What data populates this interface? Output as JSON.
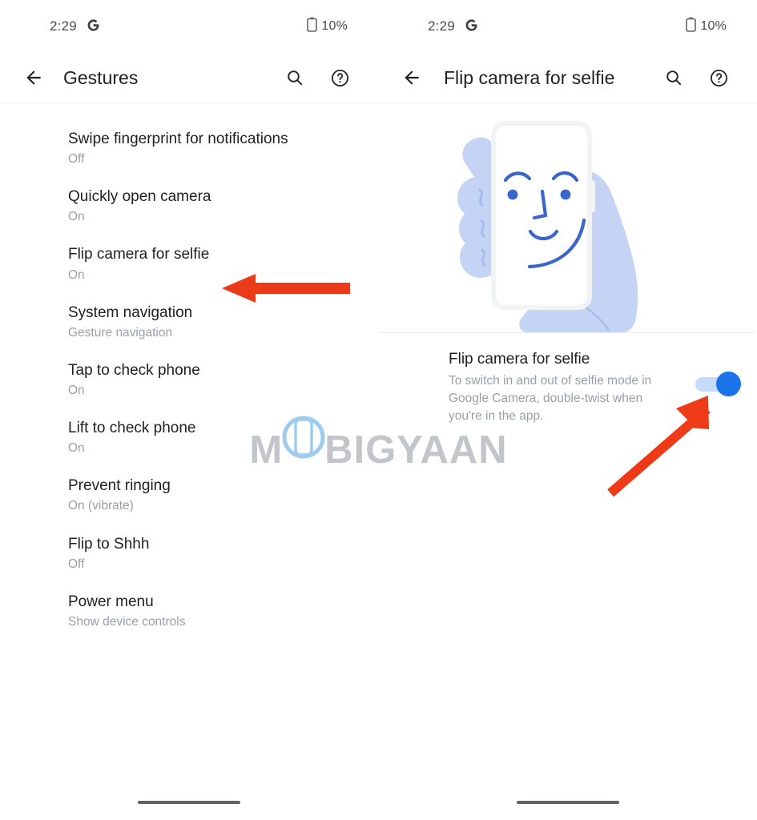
{
  "left_panel": {
    "status_bar": {
      "time": "2:29",
      "app_logo": "google-g-logo",
      "battery_icon": "battery-icon",
      "battery_level": "10%"
    },
    "app_bar": {
      "back_icon": "back-arrow-icon",
      "title": "Gestures",
      "search_icon": "search-icon",
      "help_icon": "help-circle-icon"
    },
    "settings": [
      {
        "title": "Swipe fingerprint for notifications",
        "value": "Off"
      },
      {
        "title": "Quickly open camera",
        "value": "On"
      },
      {
        "title": "Flip camera for selfie",
        "value": "On"
      },
      {
        "title": "System navigation",
        "value": "Gesture navigation"
      },
      {
        "title": "Tap to check phone",
        "value": "On"
      },
      {
        "title": "Lift to check phone",
        "value": "On"
      },
      {
        "title": "Prevent ringing",
        "value": "On (vibrate)"
      },
      {
        "title": "Flip to Shhh",
        "value": "Off"
      },
      {
        "title": "Power menu",
        "value": "Show device controls"
      }
    ],
    "nav_pill": "gesture-nav-pill"
  },
  "right_panel": {
    "status_bar": {
      "time": "2:29",
      "app_logo": "google-g-logo",
      "battery_icon": "battery-icon",
      "battery_level": "10%"
    },
    "app_bar": {
      "back_icon": "back-arrow-icon",
      "title": "Flip camera for selfie",
      "search_icon": "search-icon",
      "help_icon": "help-circle-icon"
    },
    "illustration": "hand-holding-phone-selfie-face-illustration",
    "detail": {
      "title": "Flip camera for selfie",
      "description": "To switch in and out of selfie mode in Google Camera, double-twist when you're in the app.",
      "toggle_state": "on"
    },
    "nav_pill": "gesture-nav-pill"
  },
  "annotations": {
    "arrow_left": "red-arrow-pointing-left",
    "arrow_diagonal": "red-arrow-pointing-upper-right",
    "color": "#EA3B1B"
  },
  "watermark": {
    "text_before": "M",
    "text_after": "BIGYAAN",
    "icon": "phone-in-circle-icon",
    "color": "#C2C6CA",
    "accent": "#9ECBF0"
  }
}
